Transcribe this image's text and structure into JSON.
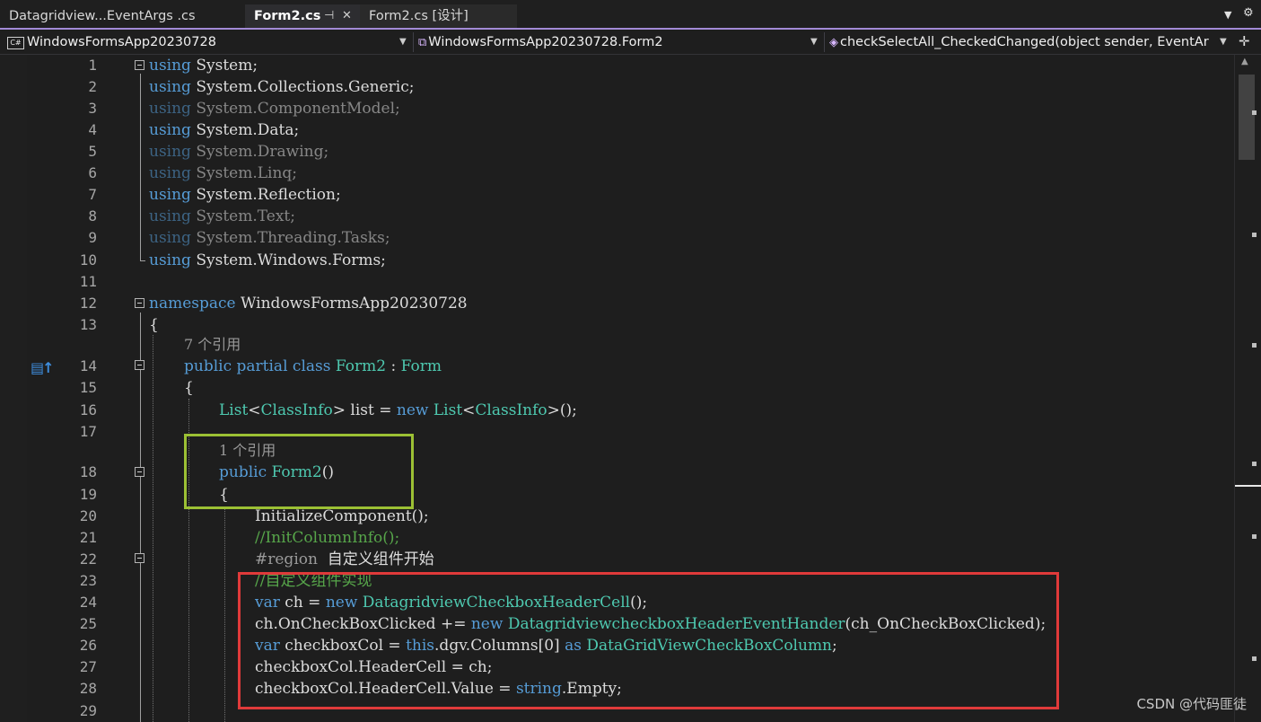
{
  "tabs": [
    {
      "label": "Datagridview...EventArgs .cs",
      "active": false
    },
    {
      "label": "Form2.cs",
      "active": true,
      "pin": "⊣",
      "close": "✕"
    },
    {
      "label": "Form2.cs [设计]",
      "active": false
    }
  ],
  "navbar": {
    "project_badge": "C#",
    "project": "WindowsFormsApp20230728",
    "class": "WindowsFormsApp20230728.Form2",
    "member": "checkSelectAll_CheckedChanged(object sender, EventAr"
  },
  "code_lens": {
    "line13": "7 个引用",
    "line17": "1 个引用"
  },
  "lines": [
    {
      "n": "1",
      "text": "using System;"
    },
    {
      "n": "2",
      "text": "using System.Collections.Generic;"
    },
    {
      "n": "3",
      "text": "using System.ComponentModel;"
    },
    {
      "n": "4",
      "text": "using System.Data;"
    },
    {
      "n": "5",
      "text": "using System.Drawing;"
    },
    {
      "n": "6",
      "text": "using System.Linq;"
    },
    {
      "n": "7",
      "text": "using System.Reflection;"
    },
    {
      "n": "8",
      "text": "using System.Text;"
    },
    {
      "n": "9",
      "text": "using System.Threading.Tasks;"
    },
    {
      "n": "10",
      "text": "using System.Windows.Forms;"
    },
    {
      "n": "11",
      "text": ""
    },
    {
      "n": "12",
      "text": "namespace WindowsFormsApp20230728"
    },
    {
      "n": "13",
      "text": "{"
    },
    {
      "n": "14",
      "text": "public partial class Form2 : Form"
    },
    {
      "n": "15",
      "text": "{"
    },
    {
      "n": "16",
      "text": "List<ClassInfo> list = new List<ClassInfo>();"
    },
    {
      "n": "17",
      "text": ""
    },
    {
      "n": "18",
      "text": "public Form2()"
    },
    {
      "n": "19",
      "text": "{"
    },
    {
      "n": "20",
      "text": "InitializeComponent();"
    },
    {
      "n": "21",
      "text": "//InitColumnInfo();"
    },
    {
      "n": "22",
      "text": "#region  自定义组件开始"
    },
    {
      "n": "23",
      "text": "//自定义组件实现"
    },
    {
      "n": "24",
      "text": "var ch = new DatagridviewCheckboxHeaderCell();"
    },
    {
      "n": "25",
      "text": "ch.OnCheckBoxClicked += new DatagridviewcheckboxHeaderEventHander(ch_OnCheckBoxClicked);"
    },
    {
      "n": "26",
      "text": "var checkboxCol = this.dgv.Columns[0] as DataGridViewCheckBoxColumn;"
    },
    {
      "n": "27",
      "text": "checkboxCol.HeaderCell = ch;"
    },
    {
      "n": "28",
      "text": "checkboxCol.HeaderCell.Value = string.Empty;"
    },
    {
      "n": "29",
      "text": ""
    }
  ],
  "watermark": "CSDN @代码匪徒"
}
